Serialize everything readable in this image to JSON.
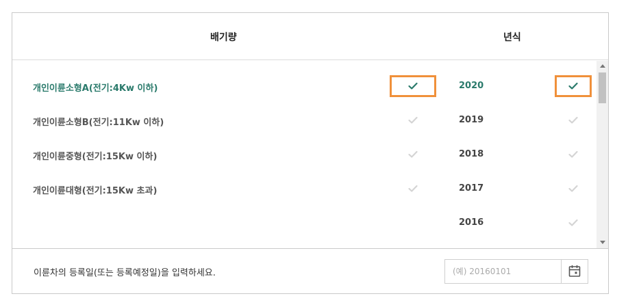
{
  "header": {
    "displacement_title": "배기량",
    "year_title": "년식"
  },
  "displacement": [
    {
      "label": "개인이륜소형A(전기:4Kw 이하)",
      "selected": true
    },
    {
      "label": "개인이륜소형B(전기:11Kw 이하)",
      "selected": false
    },
    {
      "label": "개인이륜중형(전기:15Kw 이하)",
      "selected": false
    },
    {
      "label": "개인이륜대형(전기:15Kw 초과)",
      "selected": false
    }
  ],
  "years": [
    {
      "label": "2020",
      "selected": true
    },
    {
      "label": "2019",
      "selected": false
    },
    {
      "label": "2018",
      "selected": false
    },
    {
      "label": "2017",
      "selected": false
    },
    {
      "label": "2016",
      "selected": false
    }
  ],
  "footer": {
    "instruction": "이륜차의 등록일(또는 등록예정일)을 입력하세요.",
    "date_placeholder": "(예) 20160101"
  },
  "colors": {
    "accent": "#2a7a6b",
    "highlight_box": "#f0903a",
    "check_inactive": "#d4d4d4"
  },
  "icons": {
    "check": "check-icon",
    "calendar": "calendar-icon"
  }
}
